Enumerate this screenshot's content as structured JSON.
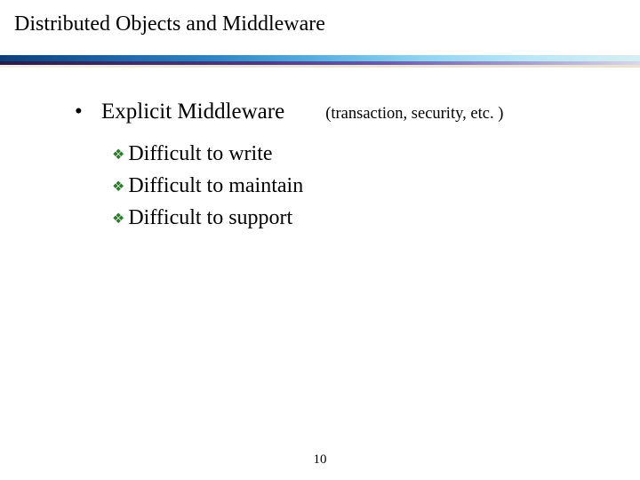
{
  "title": "Distributed Objects and Middleware",
  "bullet": {
    "marker": "•",
    "label": "Explicit Middleware",
    "paren": "(transaction, security, etc. )"
  },
  "subbullets": [
    {
      "marker": "❖",
      "text": "Difficult to write"
    },
    {
      "marker": "❖",
      "text": "Difficult to maintain"
    },
    {
      "marker": "❖",
      "text": "Difficult to support"
    }
  ],
  "page_number": "10"
}
